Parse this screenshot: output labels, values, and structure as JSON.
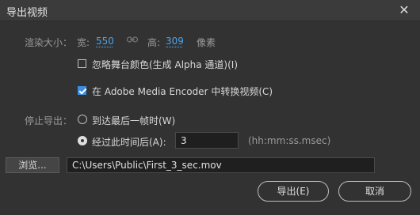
{
  "window": {
    "title": "导出视频",
    "close_glyph": "✕"
  },
  "render_size": {
    "label": "渲染大小：",
    "width_label": "宽:",
    "width_value": "550",
    "height_label": "高:",
    "height_value": "309",
    "unit": "像素",
    "link_icon": "link-icon"
  },
  "options": {
    "ignore_stage_color": {
      "label": "忽略舞台颜色(生成 Alpha 通道)(I)",
      "checked": false
    },
    "convert_in_encoder": {
      "label": "在 Adobe Media Encoder 中转换视频(C)",
      "checked": true
    }
  },
  "stop_export": {
    "label": "停止导出：",
    "option_last_frame": {
      "label": "到达最后一帧时(W)",
      "selected": false
    },
    "option_after_time": {
      "label": "经过此时间后(A):",
      "selected": true
    },
    "time_value": "3",
    "time_format": "(hh:mm:ss.msec)"
  },
  "file": {
    "browse_label": "浏览...",
    "path": "C:\\Users\\Public\\First_3_sec.mov"
  },
  "actions": {
    "export_label": "导出(E)",
    "cancel_label": "取消"
  },
  "colors": {
    "background": "#323232",
    "accent": "#3c8ee0",
    "value_link": "#4fa2e6"
  }
}
